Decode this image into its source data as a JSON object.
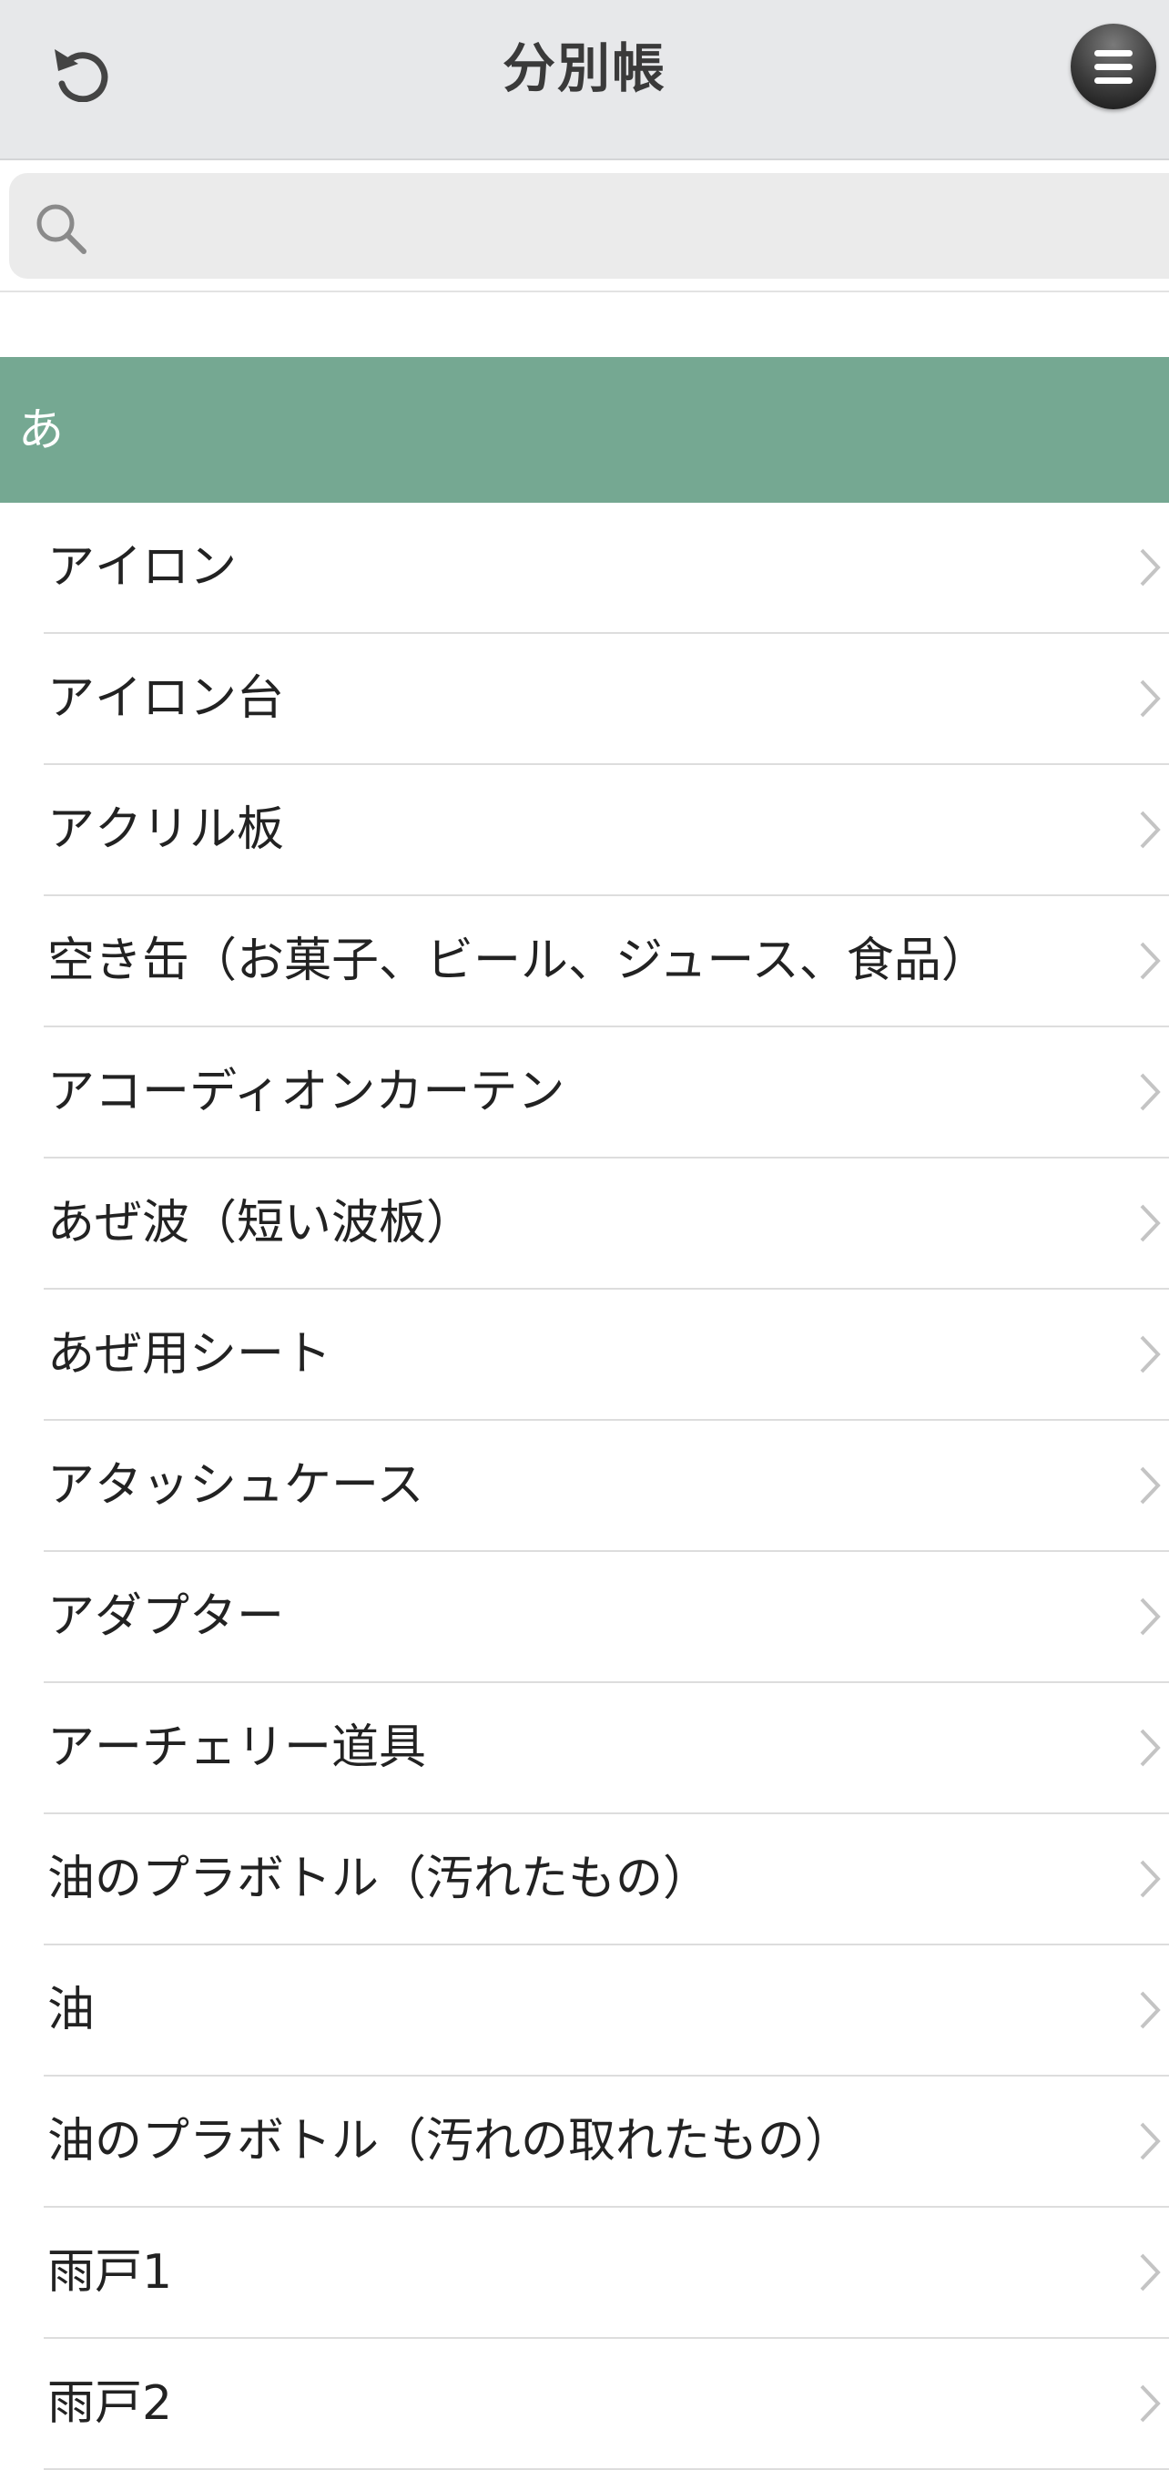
{
  "header": {
    "title": "分別帳",
    "back_icon": "undo-icon",
    "menu_icon": "hamburger-menu-icon"
  },
  "search": {
    "placeholder": "",
    "value": "",
    "icon": "search-icon"
  },
  "section": {
    "label": "あ",
    "color": "#75a892"
  },
  "items": [
    "アイロン",
    "アイロン台",
    "アクリル板",
    "空き缶（お菓子、ビール、ジュース、食品）",
    "アコーディオンカーテン",
    "あぜ波（短い波板）",
    "あぜ用シート",
    "アタッシュケース",
    "アダプター",
    "アーチェリー道具",
    "油のプラボトル（汚れたもの）",
    "油",
    "油のプラボトル（汚れの取れたもの）",
    "雨戸1",
    "雨戸2"
  ]
}
